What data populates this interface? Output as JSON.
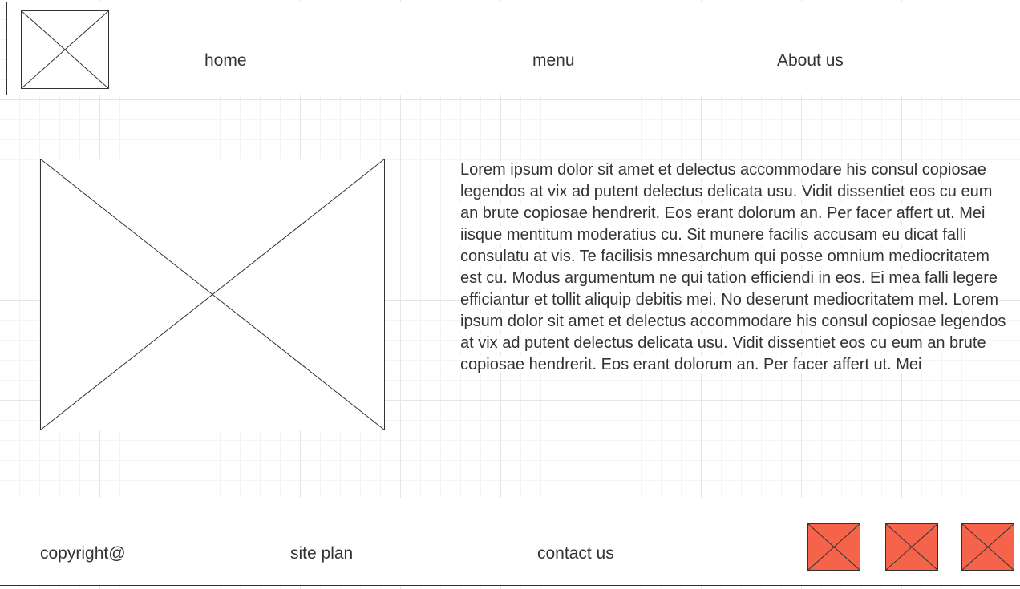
{
  "header": {
    "logo_icon": "image-placeholder-icon",
    "nav": {
      "home": "home",
      "menu": "menu",
      "about": "About us"
    }
  },
  "main": {
    "image_icon": "image-placeholder-icon",
    "text": "Lorem ipsum dolor sit amet et delectus accommodare his consul copiosae legendos at vix ad putent delectus delicata usu. Vidit dissentiet eos cu eum an brute copiosae hendrerit. Eos erant dolorum an. Per facer affert ut. Mei iisque mentitum moderatius cu. Sit munere facilis accusam eu dicat falli consulatu at vis. Te facilisis mnesarchum qui posse omnium mediocritatem est cu. Modus argumentum ne qui tation efficiendi in eos. Ei mea falli legere efficiantur et tollit aliquip debitis mei. No deserunt mediocritatem mel. Lorem ipsum dolor sit amet et delectus accommodare his consul copiosae legendos at vix ad putent delectus delicata usu. Vidit dissentiet eos cu eum an brute copiosae hendrerit. Eos erant dolorum an. Per facer affert ut. Mei"
  },
  "footer": {
    "copyright": "copyright@",
    "site_plan": "site plan",
    "contact_us": "contact us",
    "social_icons": [
      "social-icon-placeholder",
      "social-icon-placeholder",
      "social-icon-placeholder"
    ]
  },
  "colors": {
    "outline": "#333333",
    "social_fill": "#f4634a",
    "grid_major": "#e6e6e6",
    "grid_minor": "#f4f4f4"
  }
}
